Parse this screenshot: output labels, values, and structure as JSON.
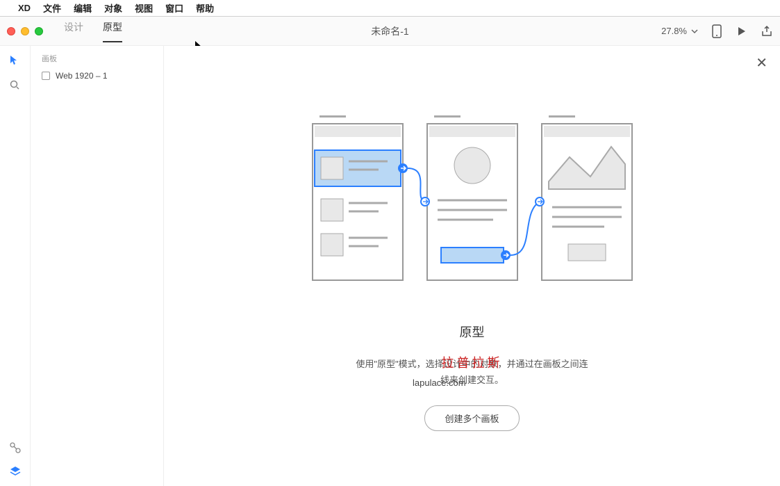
{
  "menubar": {
    "app": "XD",
    "items": [
      "文件",
      "编辑",
      "对象",
      "视图",
      "窗口",
      "帮助"
    ]
  },
  "toolbar": {
    "tab_design": "设计",
    "tab_prototype": "原型",
    "doc_title": "未命名-1",
    "zoom": "27.8%"
  },
  "sidebar": {
    "section_label": "画板",
    "items": [
      "Web 1920 – 1"
    ]
  },
  "empty_state": {
    "title": "原型",
    "desc_line1": "使用\"原型\"模式，选择设计中的对象，并通过在画板之间连",
    "desc_line2": "线来创建交互。",
    "watermark_cn": "拉普拉斯",
    "watermark_url": "lapulace.com",
    "button": "创建多个画板"
  }
}
